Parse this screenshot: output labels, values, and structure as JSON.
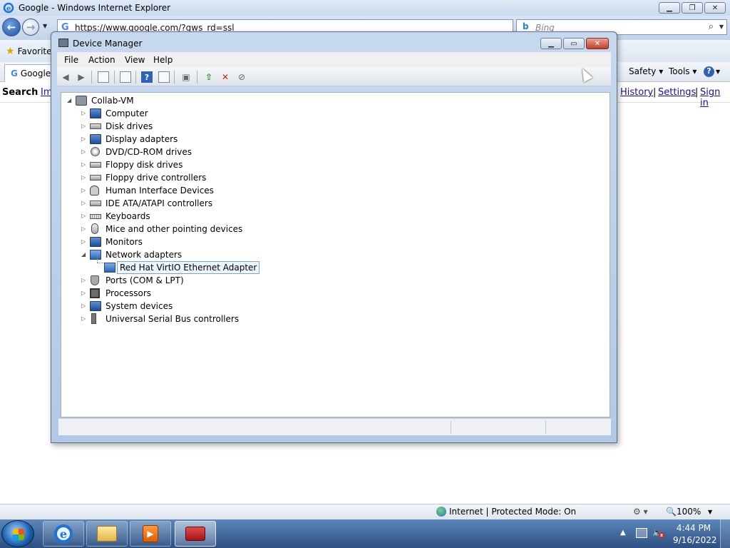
{
  "ie": {
    "title": "Google - Windows Internet Explorer",
    "address": "https://www.google.com/?gws_rd=ssl",
    "search_placeholder": "Bing",
    "favorites_label": "Favorites",
    "tab_label": "Google",
    "commands": {
      "safety": "Safety ▾",
      "tools": "Tools ▾",
      "help": "?"
    },
    "google_bar": {
      "search": "Search",
      "images": "Im",
      "history": "History",
      "settings": "Settings",
      "sign_in": "Sign in"
    },
    "status": {
      "zone": "Internet | Protected Mode: On",
      "zoom": "100%"
    }
  },
  "device_manager": {
    "title": "Device Manager",
    "menu": [
      "File",
      "Action",
      "View",
      "Help"
    ],
    "tree": {
      "root": "Collab-VM",
      "categories": [
        {
          "label": "Computer",
          "icon": "computer-icon",
          "expanded": false
        },
        {
          "label": "Disk drives",
          "icon": "disk-drive-icon",
          "expanded": false
        },
        {
          "label": "Display adapters",
          "icon": "display-adapter-icon",
          "expanded": false
        },
        {
          "label": "DVD/CD-ROM drives",
          "icon": "cdrom-icon",
          "expanded": false
        },
        {
          "label": "Floppy disk drives",
          "icon": "floppy-icon",
          "expanded": false
        },
        {
          "label": "Floppy drive controllers",
          "icon": "floppy-controller-icon",
          "expanded": false
        },
        {
          "label": "Human Interface Devices",
          "icon": "hid-icon",
          "expanded": false
        },
        {
          "label": "IDE ATA/ATAPI controllers",
          "icon": "ide-icon",
          "expanded": false
        },
        {
          "label": "Keyboards",
          "icon": "keyboard-icon",
          "expanded": false
        },
        {
          "label": "Mice and other pointing devices",
          "icon": "mouse-icon",
          "expanded": false
        },
        {
          "label": "Monitors",
          "icon": "monitor-icon",
          "expanded": false
        },
        {
          "label": "Network adapters",
          "icon": "network-adapter-icon",
          "expanded": true,
          "children": [
            "Red Hat VirtIO Ethernet Adapter"
          ]
        },
        {
          "label": "Ports (COM & LPT)",
          "icon": "port-icon",
          "expanded": false
        },
        {
          "label": "Processors",
          "icon": "processor-icon",
          "expanded": false
        },
        {
          "label": "System devices",
          "icon": "system-device-icon",
          "expanded": false
        },
        {
          "label": "Universal Serial Bus controllers",
          "icon": "usb-icon",
          "expanded": false
        }
      ]
    }
  },
  "taskbar": {
    "time": "4:44 PM",
    "date": "9/16/2022"
  }
}
